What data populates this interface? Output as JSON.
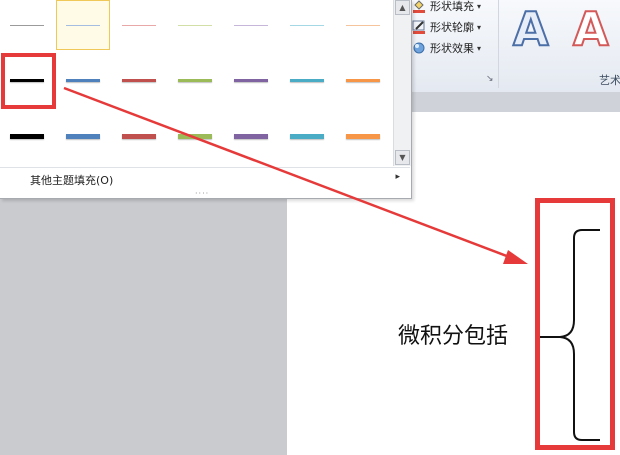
{
  "ribbon": {
    "shape_fill": "形状填充",
    "shape_outline": "形状轮廓",
    "shape_effects": "形状效果",
    "dropdown_arrow": "▾",
    "wordart_letter": "A",
    "wordart_group_label": "艺术",
    "dialog_launcher": "↘"
  },
  "dropdown": {
    "more_fills": "其他主题填充(O)",
    "more_arrow": "▸",
    "grip": "····",
    "rows": [
      {
        "thickness": 1,
        "colors": [
          "#9b9b9b",
          "#a6bde2",
          "#e8a8a8",
          "#d2e0a8",
          "#c5b6da",
          "#a5d8e5",
          "#f6c49c"
        ]
      },
      {
        "thickness": 3,
        "colors": [
          "#000000",
          "#4f81bd",
          "#c0504d",
          "#9bbb59",
          "#8064a2",
          "#4bacc6",
          "#f79646"
        ]
      },
      {
        "thickness": 5,
        "colors": [
          "#000000",
          "#4f81bd",
          "#c0504d",
          "#9bbb59",
          "#8064a2",
          "#4bacc6",
          "#f79646"
        ]
      }
    ]
  },
  "document": {
    "text": "微积分包括"
  },
  "colors": {
    "annotation_red": "#e63a3a",
    "selection_border": "#f0c85a"
  }
}
